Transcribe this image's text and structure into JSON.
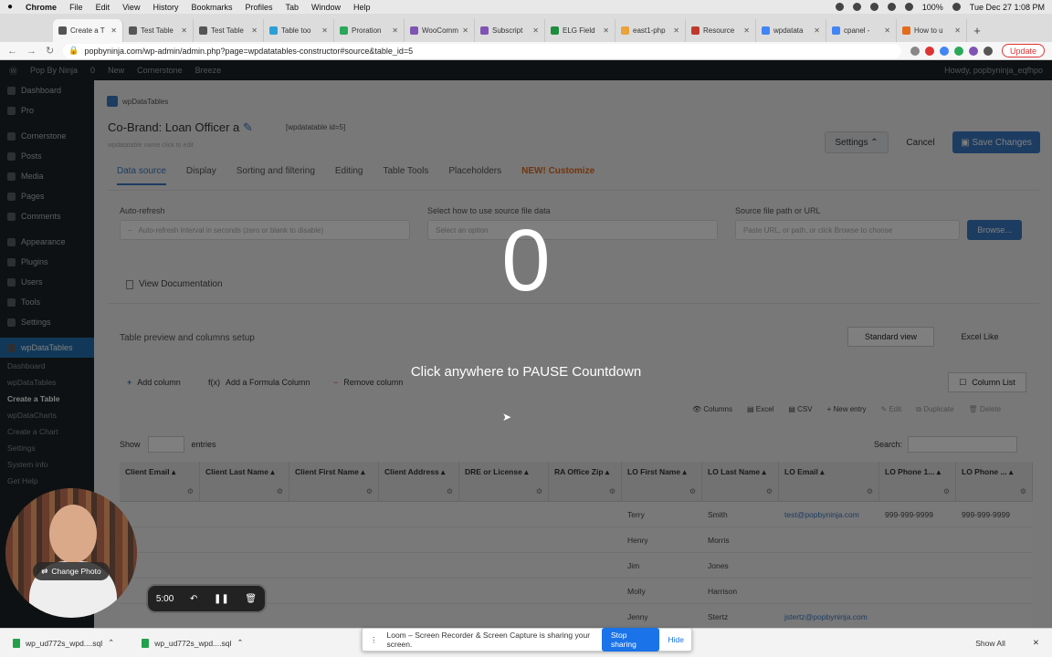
{
  "menubar": {
    "apple": "",
    "app": "Chrome",
    "items": [
      "File",
      "Edit",
      "View",
      "History",
      "Bookmarks",
      "Profiles",
      "Tab",
      "Window",
      "Help"
    ],
    "battery": "100%",
    "datetime": "Tue Dec 27  1:08 PM"
  },
  "tabs": [
    {
      "title": "Create a T",
      "color": "#555555",
      "active": true
    },
    {
      "title": "Test Table",
      "color": "#555555"
    },
    {
      "title": "Test Table",
      "color": "#555555"
    },
    {
      "title": "Table too",
      "color": "#2a9fd6"
    },
    {
      "title": "Proration",
      "color": "#2aa85a"
    },
    {
      "title": "WooComm",
      "color": "#7f54b3"
    },
    {
      "title": "Subscript",
      "color": "#7f54b3"
    },
    {
      "title": "ELG Field",
      "color": "#1e8e3e"
    },
    {
      "title": "east1-php",
      "color": "#e8a33b"
    },
    {
      "title": "Resource",
      "color": "#c0392b"
    },
    {
      "title": "wpdatata",
      "color": "#4285f4"
    },
    {
      "title": "cpanel -",
      "color": "#4285f4"
    },
    {
      "title": "How to u",
      "color": "#e36b1c"
    }
  ],
  "address": {
    "url": "popbyninja.com/wp-admin/admin.php?page=wpdatatables-constructor#source&table_id=5",
    "update_label": "Update"
  },
  "adminbar": {
    "site": "Pop By Ninja",
    "comments": "0",
    "new": "New",
    "cornerstone": "Cornerstone",
    "breeze": "Breeze",
    "howdy": "Howdy, popbyninja_eqfhpo"
  },
  "sidebar": {
    "items": [
      "Dashboard",
      "Pro",
      "Cornerstone",
      "Posts",
      "Media",
      "Pages",
      "Comments",
      "Appearance",
      "Plugins",
      "Users",
      "Tools",
      "Settings",
      "wpDataTables"
    ],
    "subitems": [
      "Dashboard",
      "wpDataTables",
      "Create a Table",
      "wpDataCharts",
      "Create a Chart",
      "Settings",
      "System info",
      "Get Help"
    ]
  },
  "page": {
    "plugin_name": "wpDataTables",
    "table_title": "Co-Brand: Loan Officer a",
    "shortcode": "[wpdatatable id=5]",
    "subtitle": "wpdatatable name click to edit",
    "settings_label": "Settings",
    "cancel_label": "Cancel",
    "save_label": "Save Changes",
    "tabs": [
      "Data source",
      "Display",
      "Sorting and filtering",
      "Editing",
      "Table Tools",
      "Placeholders"
    ],
    "tab_new_label": "NEW! Customize",
    "autorefresh_label": "Auto-refresh",
    "autorefresh_placeholder": "Auto-refresh interval in seconds (zero or blank to disable)",
    "source_label": "Select how to use source file data",
    "source_placeholder": "Select an option",
    "path_label": "Source file path or URL",
    "path_placeholder": "Paste URL, or path, or click Browse to choose",
    "browse_label": "Browse...",
    "view_doc": "View Documentation",
    "preview_title": "Table preview and columns setup",
    "view_standard": "Standard view",
    "view_excel": "Excel Like",
    "add_column": "Add column",
    "add_formula": "Add a Formula Column",
    "remove_column": "Remove column",
    "column_list": "Column List",
    "toolbar": [
      "Columns",
      "Excel",
      "CSV",
      "New entry",
      "Edit",
      "Duplicate",
      "Delete"
    ],
    "show": "Show",
    "entries": "entries",
    "search": "Search:"
  },
  "table": {
    "columns": [
      "Client Email",
      "Client Last Name",
      "Client First Name",
      "Client Address",
      "DRE or License",
      "RA Office Zip",
      "LO First Name",
      "LO Last Name",
      "LO Email",
      "LO Phone 1...",
      "LO Phone ..."
    ],
    "rows": [
      [
        "",
        "",
        "",
        "",
        "",
        "",
        "Terry",
        "Smith",
        "test@popbyninja.com",
        "999-999-9999",
        "999-999-9999"
      ],
      [
        "",
        "",
        "",
        "",
        "",
        "",
        "Henry",
        "Morris",
        "",
        "",
        ""
      ],
      [
        "",
        "",
        "",
        "",
        "",
        "",
        "Jim",
        "Jones",
        "",
        "",
        ""
      ],
      [
        "",
        "",
        "",
        "",
        "",
        "",
        "Molly",
        "Harrison",
        "",
        "",
        ""
      ],
      [
        "",
        "",
        "",
        "",
        "",
        "",
        "Jenny",
        "Stertz",
        "jstertz@popbyninja.com",
        "",
        ""
      ]
    ]
  },
  "overlay": {
    "count": "0",
    "message": "Click anywhere to PAUSE Countdown"
  },
  "loom": {
    "change_photo": "Change Photo",
    "timer": "5:00",
    "share_msg": "Loom – Screen Recorder & Screen Capture is sharing your screen.",
    "stop": "Stop sharing",
    "hide": "Hide"
  },
  "downloads": {
    "files": [
      "wp_ud772s_wpd....sql",
      "wp_ud772s_wpd....sql"
    ],
    "show_all": "Show All"
  }
}
